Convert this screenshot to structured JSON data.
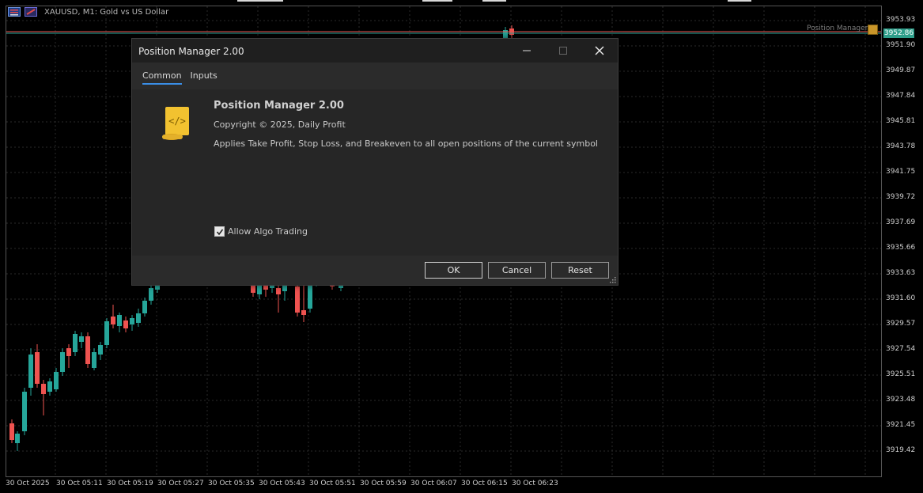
{
  "chart": {
    "symbol_title": "XAUUSD, M1:  Gold vs US Dollar",
    "current_price": "3952.86",
    "ea_label": "Position Manager",
    "price_axis": [
      "3953.93",
      "3951.90",
      "3949.87",
      "3947.84",
      "3945.81",
      "3943.78",
      "3941.75",
      "3939.72",
      "3937.69",
      "3935.66",
      "3933.63",
      "3931.60",
      "3929.57",
      "3927.54",
      "3925.51",
      "3923.48",
      "3921.45",
      "3919.42"
    ],
    "time_axis": [
      "30 Oct 2025",
      "30 Oct 05:11",
      "30 Oct 05:19",
      "30 Oct 05:27",
      "30 Oct 05:35",
      "30 Oct 05:43",
      "30 Oct 05:51",
      "30 Oct 05:59",
      "30 Oct 06:07",
      "30 Oct 06:15",
      "30 Oct 06:23"
    ],
    "colors": {
      "bull": "#26a69a",
      "bear": "#ef5350",
      "grid": "#2a2a2a",
      "ask_line": "#ef5350",
      "bid_line": "#26a69a"
    }
  },
  "dialog": {
    "title": "Position Manager 2.00",
    "tabs": [
      {
        "label": "Common",
        "active": true
      },
      {
        "label": "Inputs",
        "active": false
      }
    ],
    "app_name": "Position Manager 2.00",
    "copyright": "Copyright © 2025, Daily Profit",
    "description": "Applies Take Profit, Stop Loss, and Breakeven to all open positions of the current symbol",
    "allow_algo_label": "Allow Algo Trading",
    "allow_algo_checked": true,
    "buttons": {
      "ok": "OK",
      "cancel": "Cancel",
      "reset": "Reset"
    },
    "icons": {
      "app": "script-scroll-icon",
      "minimize": "minimize-icon",
      "maximize": "maximize-icon",
      "close": "close-icon"
    }
  }
}
